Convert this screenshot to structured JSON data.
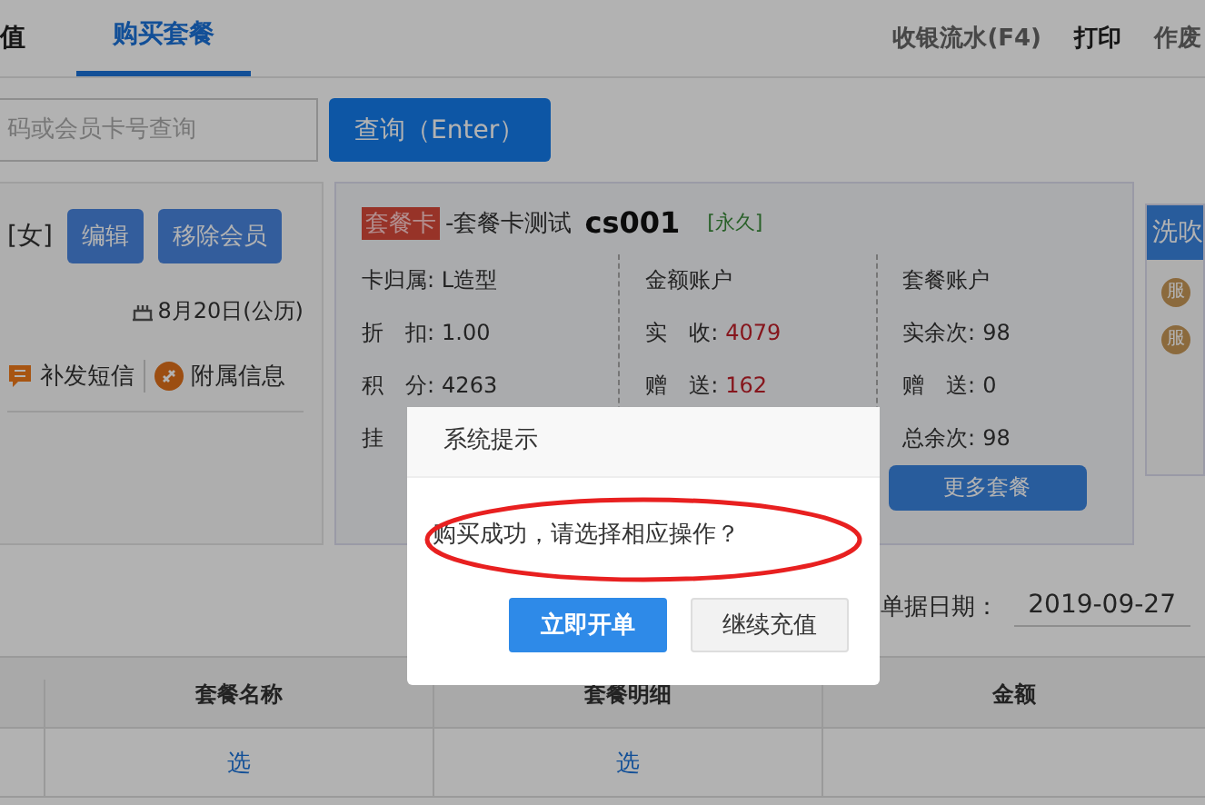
{
  "tabs": [
    {
      "label": "值",
      "selected": false
    },
    {
      "label": "购买套餐",
      "selected": true
    }
  ],
  "toolbar": [
    {
      "label": "收银流水(F4)",
      "bold": false
    },
    {
      "label": "打印",
      "bold": true
    },
    {
      "label": "作废",
      "bold": false
    }
  ],
  "search": {
    "placeholder": "码或会员卡号查询",
    "button": "查询（Enter）"
  },
  "member": {
    "gender": "[女]",
    "buttons": [
      "编辑",
      "移除会员"
    ],
    "birthday": "8月20日(公历)",
    "links": [
      {
        "kind": "sms",
        "label": "补发短信"
      },
      {
        "kind": "attach",
        "label": "附属信息"
      }
    ]
  },
  "card": {
    "tag": "套餐卡",
    "name": "-套餐卡测试",
    "code": "cs001",
    "validity": "[永久]",
    "columns": [
      {
        "title": "卡归属: L造型",
        "rows": [
          {
            "label": "折　扣:",
            "value": "1.00",
            "highlight": false
          },
          {
            "label": "积　分:",
            "value": "4263",
            "highlight": false
          },
          {
            "label": "挂"
          }
        ]
      },
      {
        "title": "金额账户",
        "rows": [
          {
            "label": "实　收:",
            "value": "4079",
            "highlight": true
          },
          {
            "label": "赠　送:",
            "value": "162",
            "highlight": true
          }
        ]
      },
      {
        "title": "套餐账户",
        "rows": [
          {
            "label": "实余次:",
            "value": "98",
            "highlight": false
          },
          {
            "label": "赠　送:",
            "value": "0",
            "highlight": false
          },
          {
            "label": "总余次:",
            "value": "98",
            "highlight": false
          }
        ]
      }
    ],
    "more_button": "更多套餐"
  },
  "side_panel": {
    "title": "洗吹",
    "items": [
      {
        "badge": "服"
      },
      {
        "badge": "服"
      }
    ]
  },
  "bill_date": {
    "label": "单据日期：",
    "value": "2019-09-27"
  },
  "table": {
    "columns": [
      "",
      "套餐名称",
      "套餐明细",
      "金额"
    ],
    "rows": [
      [
        "",
        "选",
        "选",
        ""
      ]
    ]
  },
  "dialog": {
    "title": "系统提示",
    "message": "购买成功，请选择相应操作？",
    "buttons": [
      {
        "label": "立即开单",
        "primary": true
      },
      {
        "label": "继续充值",
        "primary": false
      }
    ]
  }
}
